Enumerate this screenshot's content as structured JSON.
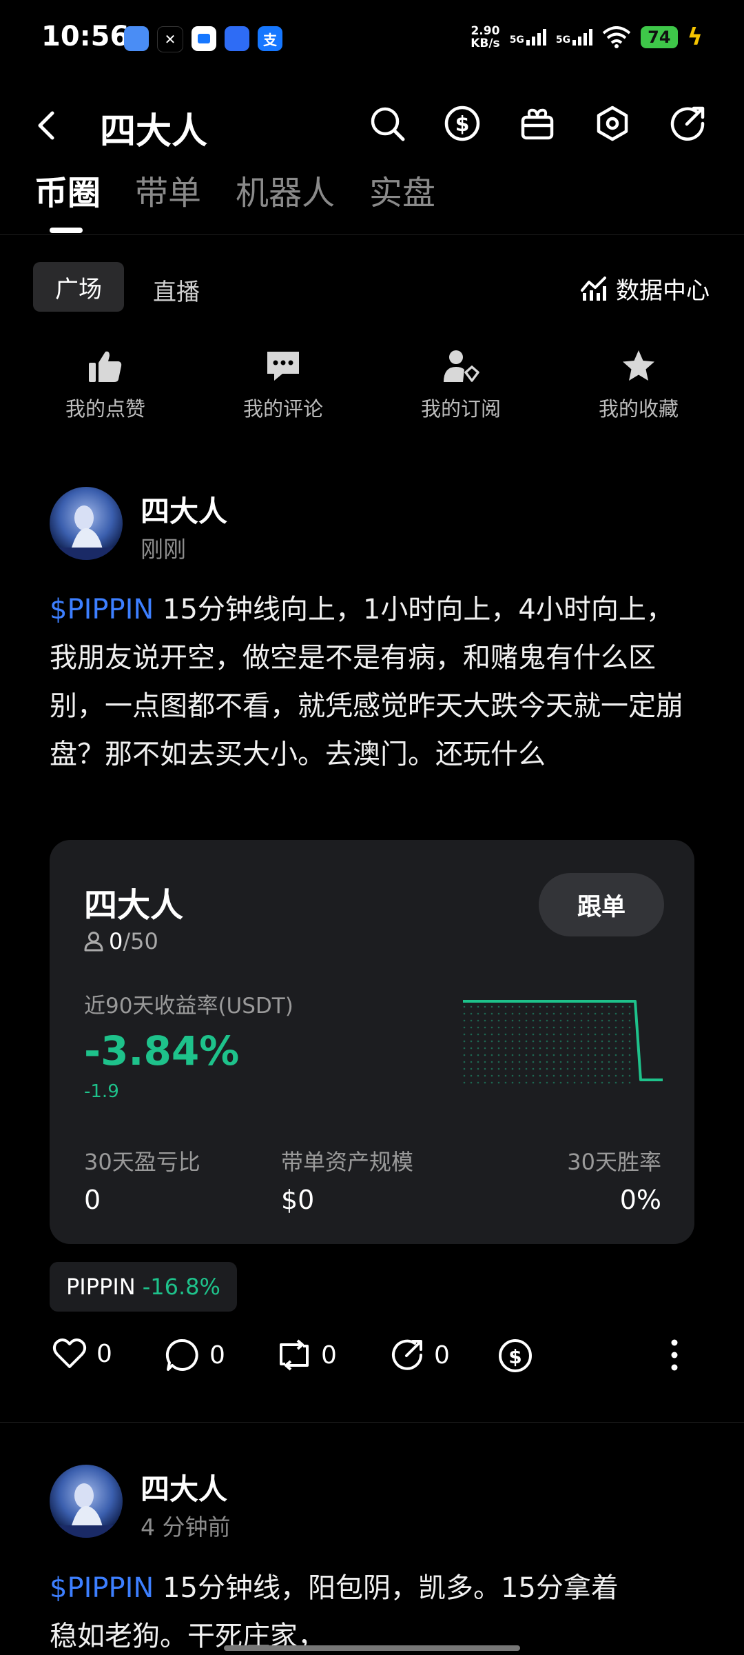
{
  "status_bar": {
    "time": "10:56",
    "net_speed_value": "2.90",
    "net_speed_unit": "KB/s",
    "sim1": "5G",
    "sim2": "5G",
    "battery": "74"
  },
  "header": {
    "title": "四大人",
    "icons": [
      "search-icon",
      "dollar-icon",
      "gift-icon",
      "settings-icon",
      "share-icon"
    ]
  },
  "tabs": [
    {
      "label": "币圈",
      "active": true
    },
    {
      "label": "带单",
      "active": false
    },
    {
      "label": "机器人",
      "active": false
    },
    {
      "label": "实盘",
      "active": false
    }
  ],
  "subtabs": {
    "active": "广场",
    "other": "直播",
    "data_center": "数据中心"
  },
  "quick_actions": [
    {
      "label": "我的点赞",
      "icon": "thumbs-up-icon"
    },
    {
      "label": "我的评论",
      "icon": "comment-icon"
    },
    {
      "label": "我的订阅",
      "icon": "subscribe-icon"
    },
    {
      "label": "我的收藏",
      "icon": "star-icon"
    }
  ],
  "posts": [
    {
      "author": "四大人",
      "time": "刚刚",
      "ticker": "$PIPPIN",
      "text": " 15分钟线向上，1小时向上，4小时向上，我朋友说开空，做空是不是有病，和赌鬼有什么区别，一点图都不看，就凭感觉昨天大跌今天就一定崩盘？那不如去买大小。去澳门。还玩什么",
      "card": {
        "name": "四大人",
        "followers": "0",
        "followers_max": "/50",
        "follow_button": "跟单",
        "roi_label": "近90天收益率(USDT)",
        "roi": "-3.84%",
        "roi_sub": "-1.9",
        "stats": [
          {
            "label": "30天盈亏比",
            "value": "0"
          },
          {
            "label": "带单资产规模",
            "value": "$0"
          },
          {
            "label": "30天胜率",
            "value": "0%"
          }
        ]
      },
      "chip": {
        "symbol": "PIPPIN",
        "change": "-16.8%"
      },
      "actions": {
        "likes": "0",
        "comments": "0",
        "reposts": "0",
        "shares": "0"
      }
    },
    {
      "author": "四大人",
      "time": "4 分钟前",
      "ticker": "$PIPPIN",
      "text_line1": " 15分钟线，阳包阴，凯多。15分拿着",
      "text_line2": "稳如老狗。干死庄家，"
    }
  ],
  "colors": {
    "accent_green": "#1ec28b",
    "link_blue": "#3d7fff",
    "card_bg": "#1c1d20"
  }
}
